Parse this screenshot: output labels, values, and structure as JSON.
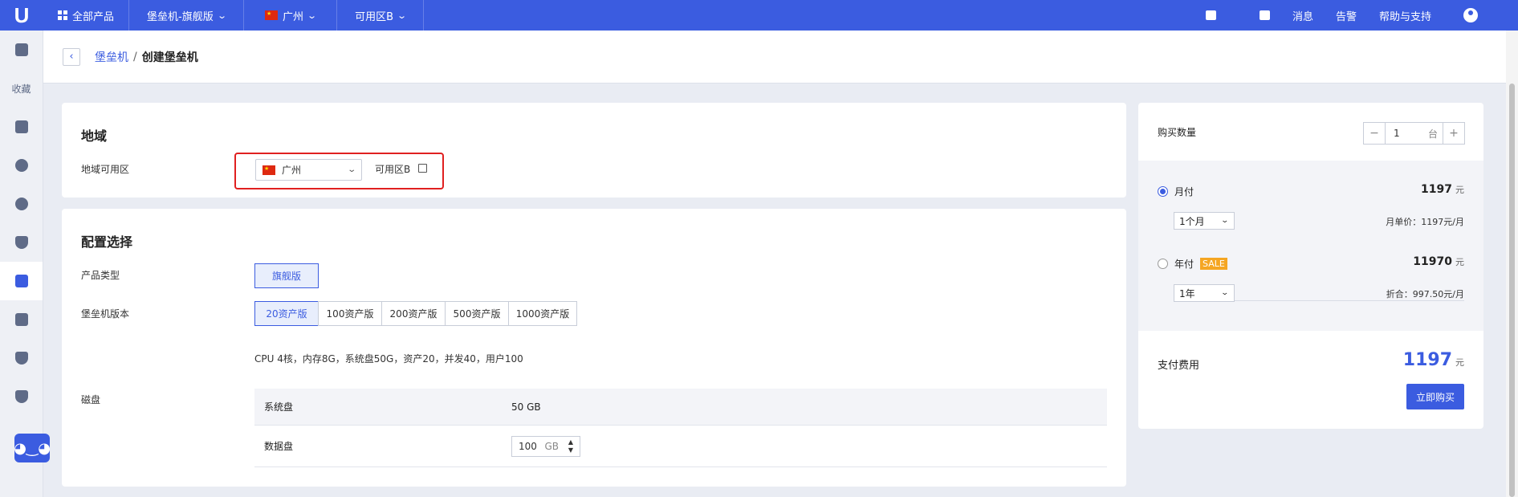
{
  "topbar": {
    "logo": "U",
    "all_products": "全部产品",
    "product": "堡垒机-旗舰版",
    "region": "广州",
    "zone": "可用区B",
    "messages": "消息",
    "alerts": "告警",
    "help": "帮助与支持",
    "accent_color": "#3b5ce0"
  },
  "sidebar": {
    "favorites": "收藏"
  },
  "breadcrumb": {
    "parent": "堡垒机",
    "separator": "/",
    "current": "创建堡垒机"
  },
  "region_card": {
    "title": "地域",
    "field_label": "地域可用区",
    "region_value": "广州",
    "zone_value": "可用区B"
  },
  "config_card": {
    "title": "配置选择",
    "product_type_label": "产品类型",
    "product_type_option": "旗舰版",
    "version_label": "堡垒机版本",
    "versions": [
      "20资产版",
      "100资产版",
      "200资产版",
      "500资产版",
      "1000资产版"
    ],
    "selected_version": "20资产版",
    "spec_text": "CPU 4核，内存8G，系统盘50G，资产20，并发40，用户100",
    "disk_label": "磁盘",
    "system_disk_label": "系统盘",
    "system_disk_value": "50 GB",
    "data_disk_label": "数据盘",
    "data_disk_value": "100",
    "data_disk_unit": "GB"
  },
  "order": {
    "quantity_label": "购买数量",
    "quantity_value": "1",
    "quantity_unit": "台",
    "monthly_label": "月付",
    "monthly_price": "1197",
    "currency": "元",
    "monthly_period": "1个月",
    "monthly_unit_price": "月单价：1197元/月",
    "yearly_label": "年付",
    "sale_badge": "SALE",
    "yearly_price": "11970",
    "yearly_period": "1年",
    "yearly_discount": "折合：997.50元/月",
    "total_label": "支付费用",
    "total_price": "1197",
    "buy_button": "立即购买"
  }
}
